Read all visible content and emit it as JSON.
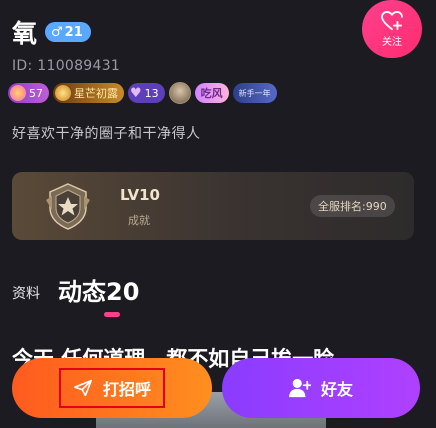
{
  "profile": {
    "name": "氧",
    "gender_symbol": "♂",
    "age": "21",
    "uid": "ID: 110089431",
    "bio": "好喜欢干净的圈子和干净得人"
  },
  "follow": {
    "label": "关注"
  },
  "badges": {
    "level": "57",
    "star_label": "星芒初露",
    "heart_count": "13",
    "chi_label": "吃风",
    "novice_label": "新手一年"
  },
  "achievement": {
    "level": "LV10",
    "subtitle": "成就",
    "rank": "全服排名:990"
  },
  "tabs": {
    "info": "资料",
    "moments": "动态20"
  },
  "post_preview": "今天  任何道理，都不如自己挨一睑",
  "actions": {
    "greet": "打招呼",
    "friend": "好友"
  },
  "colors": {
    "accent_pink": "#ff3f8e",
    "greet_orange": "#ff7a1f",
    "friend_purple": "#9b3eff",
    "highlight_red": "#e3001b"
  }
}
